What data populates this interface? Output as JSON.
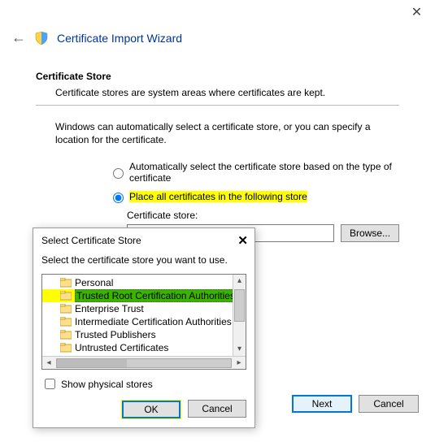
{
  "window": {
    "title": "Certificate Import Wizard"
  },
  "section": {
    "heading": "Certificate Store",
    "subtext": "Certificate stores are system areas where certificates are kept."
  },
  "body": {
    "intro": "Windows can automatically select a certificate store, or you can specify a location for the certificate.",
    "radio_auto": "Automatically select the certificate store based on the type of certificate",
    "radio_manual": "Place all certificates in the following store",
    "store_label": "Certificate store:",
    "store_value": "",
    "browse": "Browse..."
  },
  "buttons": {
    "next": "Next",
    "cancel": "Cancel"
  },
  "dialog": {
    "title": "Select Certificate Store",
    "instruction": "Select the certificate store you want to use.",
    "items": [
      "Personal",
      "Trusted Root Certification Authorities",
      "Enterprise Trust",
      "Intermediate Certification Authorities",
      "Trusted Publishers",
      "Untrusted Certificates"
    ],
    "show_physical": "Show physical stores",
    "ok": "OK",
    "cancel": "Cancel"
  }
}
